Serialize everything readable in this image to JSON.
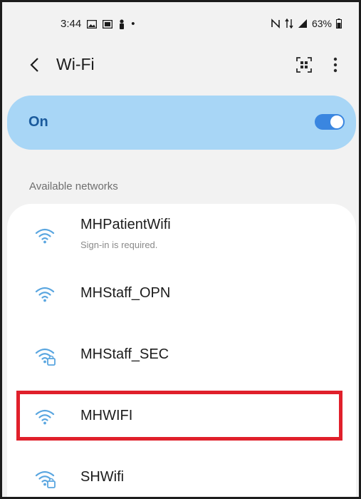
{
  "status_bar": {
    "time": "3:44",
    "dot": "•",
    "battery": "63%",
    "icons": [
      "gallery-icon",
      "screen-icon",
      "person-icon",
      "nfc-icon",
      "data-icon",
      "signal-icon",
      "battery-icon"
    ]
  },
  "app_bar": {
    "title": "Wi-Fi",
    "icons": [
      "back-arrow-icon",
      "qr-scan-icon",
      "more-vertical-icon"
    ]
  },
  "toggle": {
    "label": "On",
    "state": "on",
    "accent": "#3a86e0",
    "card_color": "#a8d6f6"
  },
  "section": {
    "label": "Available networks"
  },
  "networks": [
    {
      "name": "MHPatientWifi",
      "sub": "Sign-in is required.",
      "icon": "wifi-icon"
    },
    {
      "name": "MHStaff_OPN",
      "sub": "",
      "icon": "wifi-icon"
    },
    {
      "name": "MHStaff_SEC",
      "sub": "",
      "icon": "wifi-lock-icon"
    },
    {
      "name": "MHWIFI",
      "sub": "",
      "icon": "wifi-icon",
      "highlighted": true
    },
    {
      "name": "SHWifi",
      "sub": "",
      "icon": "wifi-lock-icon"
    }
  ],
  "highlight_color": "#e0202b"
}
